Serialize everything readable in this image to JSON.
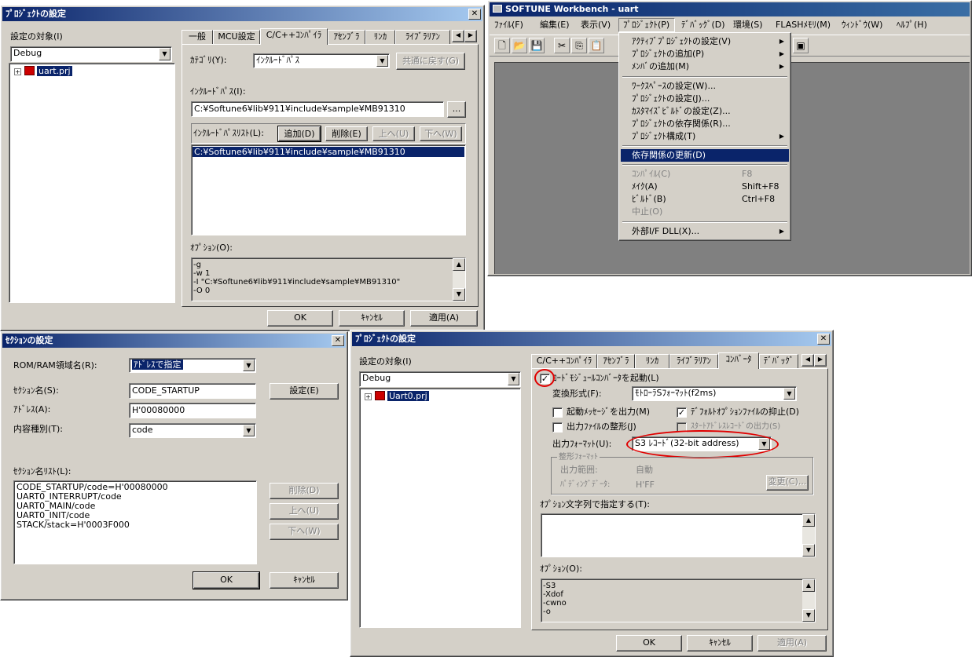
{
  "proj_dialog_1": {
    "title": "ﾌﾟﾛｼﾞｪｸﾄの設定",
    "target_label": "設定の対象(I)",
    "target_value": "Debug",
    "tree_item": "uart.prj",
    "tabs": [
      "一般",
      "MCU設定",
      "C/C++ｺﾝﾊﾟｲﾗ",
      "ｱｾﾝﾌﾞﾗ",
      "ﾘﾝｶ",
      "ﾗｲﾌﾞﾗﾘｱﾝ"
    ],
    "category_label": "ｶﾃｺﾞﾘ(Y):",
    "category_value": "ｲﾝｸﾙｰﾄﾞﾊﾟｽ",
    "common_revert_btn": "共通に戻す(G)",
    "include_path_label": "ｲﾝｸﾙｰﾄﾞﾊﾟｽ(I):",
    "include_path_value": "C:¥Softune6¥lib¥911¥include¥sample¥MB91310",
    "browse_btn": "...",
    "include_list_label": "ｲﾝｸﾙｰﾄﾞﾊﾟｽﾘｽﾄ(L):",
    "add_btn": "追加(D)",
    "delete_btn": "削除(E)",
    "up_btn": "上へ(U)",
    "down_btn": "下へ(W)",
    "include_list_item": "C:¥Softune6¥lib¥911¥include¥sample¥MB91310",
    "options_label": "ｵﾌﾟｼｮﾝ(O):",
    "options_text": "-g\n-w 1\n-I \"C:¥Softune6¥lib¥911¥include¥sample¥MB91310\"\n-O 0",
    "ok_btn": "OK",
    "cancel_btn": "ｷｬﾝｾﾙ",
    "apply_btn": "適用(A)"
  },
  "workbench": {
    "title": "SOFTUNE Workbench - uart",
    "menu": [
      "ﾌｧｲﾙ(F)",
      "編集(E)",
      "表示(V)",
      "ﾌﾟﾛｼﾞｪｸﾄ(P)",
      "ﾃﾞﾊﾞｯｸﾞ(D)",
      "環境(S)",
      "FLASHﾒﾓﾘ(M)",
      "ｳｨﾝﾄﾞｳ(W)",
      "ﾍﾙﾌﾟ(H)"
    ],
    "dropdown": {
      "active_project": "ｱｸﾃｨﾌﾞﾌﾟﾛｼﾞｪｸﾄの設定(V)",
      "add_project": "ﾌﾟﾛｼﾞｪｸﾄの追加(P)",
      "add_member": "ﾒﾝﾊﾞの追加(M)",
      "workspace_settings": "ﾜｰｸｽﾍﾟｰｽの設定(W)...",
      "project_settings": "ﾌﾟﾛｼﾞｪｸﾄの設定(J)...",
      "custom_build": "ｶｽﾀﾏｲｽﾞﾋﾞﾙﾄﾞの設定(Z)...",
      "dependencies": "ﾌﾟﾛｼﾞｪｸﾄの依存関係(R)...",
      "project_config": "ﾌﾟﾛｼﾞｪｸﾄ構成(T)",
      "update_deps": "依存関係の更新(D)",
      "compile": "ｺﾝﾊﾟｲﾙ(C)",
      "compile_sc": "F8",
      "make": "ﾒｲｸ(A)",
      "make_sc": "Shift+F8",
      "build": "ﾋﾞﾙﾄﾞ(B)",
      "build_sc": "Ctrl+F8",
      "stop": "中止(O)",
      "external_dll": "外部I/F DLL(X)..."
    }
  },
  "section_dialog": {
    "title": "ｾｸｼｮﾝの設定",
    "rom_ram_label": "ROM/RAM領域名(R):",
    "rom_ram_value": "ｱﾄﾞﾚｽで指定",
    "section_name_label": "ｾｸｼｮﾝ名(S):",
    "section_name_value": "CODE_STARTUP",
    "set_btn": "設定(E)",
    "address_label": "ｱﾄﾞﾚｽ(A):",
    "address_value": "H'00080000",
    "content_type_label": "内容種別(T):",
    "content_type_value": "code",
    "section_list_label": "ｾｸｼｮﾝ名ﾘｽﾄ(L):",
    "section_list": [
      "CODE_STARTUP/code=H'00080000",
      "UART0_INTERRUPT/code",
      "UART0_MAIN/code",
      "UART0_INIT/code",
      "STACK/stack=H'0003F000"
    ],
    "delete_btn": "削除(D)",
    "up_btn": "上へ(U)",
    "down_btn": "下へ(W)",
    "ok_btn": "OK",
    "cancel_btn": "ｷｬﾝｾﾙ"
  },
  "proj_dialog_2": {
    "title": "ﾌﾟﾛｼﾞｪｸﾄの設定",
    "target_label": "設定の対象(I)",
    "target_value": "Debug",
    "tree_item": "Uart0.prj",
    "tabs": [
      "C/C++ｺﾝﾊﾟｲﾗ",
      "ｱｾﾝﾌﾞﾗ",
      "ﾘﾝｶ",
      "ﾗｲﾌﾞﾗﾘｱﾝ",
      "ｺﾝﾊﾞｰﾀ",
      "ﾃﾞﾊﾞｯｸﾞ"
    ],
    "start_converter": "ﾛｰﾄﾞﾓｼﾞｭｰﾙｺﾝﾊﾞｰﾀを起動(L)",
    "conv_format_label": "変換形式(F):",
    "conv_format_value": "ﾓﾄﾛｰﾗSﾌｫｰﾏｯﾄ(f2ms)",
    "startup_msg": "起動ﾒｯｾｰｼﾞを出力(M)",
    "suppress_default": "ﾃﾞﾌｫﾙﾄｵﾌﾟｼｮﾝﾌｧｲﾙの抑止(D)",
    "format_output": "出力ﾌｧｲﾙの整形(J)",
    "start_address_record": "ｽﾀｰﾄｱﾄﾞﾚｽﾚｺｰﾄﾞの出力(S)",
    "output_format_label": "出力ﾌｫｰﾏｯﾄ(U):",
    "output_format_value": "S3 ﾚｺｰﾄﾞ(32-bit address)",
    "shaping_group": "整形ﾌｫｰﾏｯﾄ",
    "output_range_label": "出力範囲:",
    "output_range_value": "自動",
    "padding_label": "ﾊﾟﾃﾞｨﾝｸﾞﾃﾞｰﾀ:",
    "padding_value": "H'FF",
    "change_btn": "変更(C)...",
    "option_string_label": "ｵﾌﾟｼｮﾝ文字列で指定する(T):",
    "options_label": "ｵﾌﾟｼｮﾝ(O):",
    "options_text": "-S3\n-Xdof\n-cwno\n-o",
    "ok_btn": "OK",
    "cancel_btn": "ｷｬﾝｾﾙ",
    "apply_btn": "適用(A)"
  },
  "colors": {
    "titlebar": "#0a246a",
    "face": "#d4d0c8",
    "highlight_red": "#e00000"
  }
}
